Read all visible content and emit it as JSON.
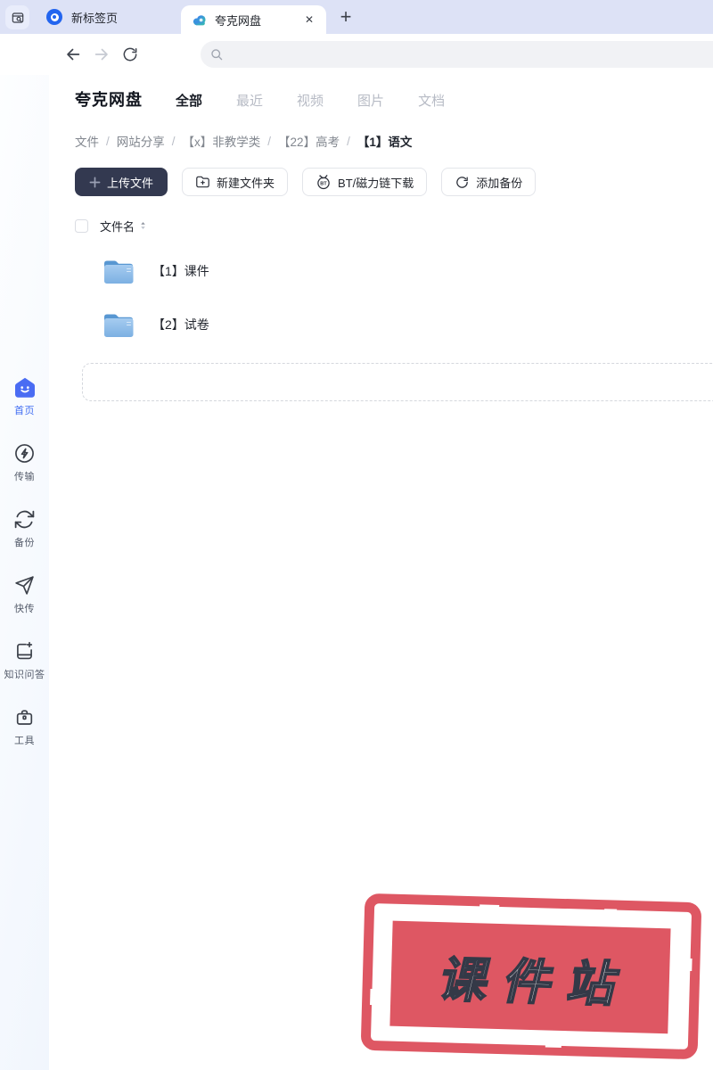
{
  "browser": {
    "tabs": [
      {
        "label": "新标签页",
        "active": false
      },
      {
        "label": "夸克网盘",
        "active": true
      }
    ],
    "close_label": "✕",
    "new_tab_label": "+"
  },
  "toolbar": {
    "address_value": ""
  },
  "sidebar": {
    "items": [
      {
        "label": "首页",
        "active": true
      },
      {
        "label": "传输",
        "active": false
      },
      {
        "label": "备份",
        "active": false
      },
      {
        "label": "快传",
        "active": false
      },
      {
        "label": "知识问答",
        "active": false
      },
      {
        "label": "工具",
        "active": false
      }
    ]
  },
  "main": {
    "title": "夸克网盘",
    "filters": [
      {
        "label": "全部",
        "active": true
      },
      {
        "label": "最近",
        "active": false
      },
      {
        "label": "视频",
        "active": false
      },
      {
        "label": "图片",
        "active": false
      },
      {
        "label": "文档",
        "active": false
      }
    ],
    "breadcrumb": {
      "items": [
        "文件",
        "网站分享",
        "【x】非教学类",
        "【22】高考"
      ],
      "current": "【1】语文",
      "separator": "/"
    },
    "actions": {
      "upload": "上传文件",
      "new_folder": "新建文件夹",
      "bt_download": "BT/磁力链下载",
      "add_backup": "添加备份"
    },
    "list": {
      "header": "文件名",
      "rows": [
        {
          "name": "【1】课件",
          "type": "folder"
        },
        {
          "name": "【2】试卷",
          "type": "folder"
        }
      ]
    }
  },
  "watermark": {
    "text": "课件站"
  },
  "colors": {
    "accent_blue": "#3f6cf2",
    "tabbar_bg": "#dde2f6",
    "upload_button": "#333950",
    "stamp_red": "#de5763",
    "folder_blue": "#7fb3e4"
  }
}
